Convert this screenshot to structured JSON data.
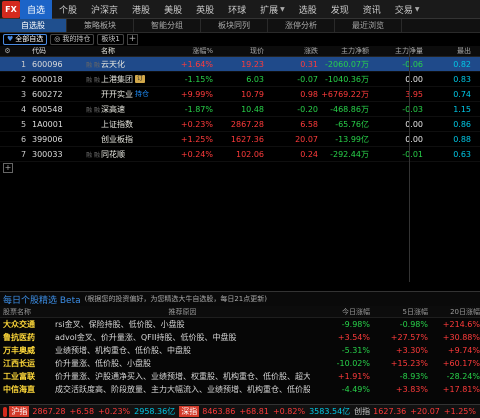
{
  "nav": {
    "logo": "FX",
    "tabs": [
      {
        "label": "自选",
        "caret": false,
        "active": true
      },
      {
        "label": "个股",
        "caret": false
      },
      {
        "label": "沪深京",
        "caret": false
      },
      {
        "label": "港股",
        "caret": false
      },
      {
        "label": "美股",
        "caret": false
      },
      {
        "label": "英股",
        "caret": false
      },
      {
        "label": "环球",
        "caret": false
      },
      {
        "label": "扩展",
        "caret": true
      },
      {
        "label": "选股",
        "caret": false
      },
      {
        "label": "发现",
        "caret": false
      },
      {
        "label": "资讯",
        "caret": false
      },
      {
        "label": "交易",
        "caret": true
      }
    ]
  },
  "subtabs": [
    "自选股",
    "策略板块",
    "智能分组",
    "板块同列",
    "涨停分析",
    "最近浏览"
  ],
  "toolbar": {
    "all": "全部自选",
    "mine": "我的持仓",
    "block": "板块1",
    "plus": "+"
  },
  "table": {
    "headers": {
      "code": "代码",
      "name": "名称",
      "chg": "涨幅%",
      "price": "现价",
      "diff": "涨跌",
      "main": "主力净额",
      "net": "主力净量",
      "last": "最出"
    },
    "rows": [
      {
        "idx": "1",
        "code": "600096",
        "tag": "融 融",
        "name": "云天化",
        "badge": "",
        "hold": "",
        "chg": "+1.64%",
        "price": "19.23",
        "diff": "0.31",
        "main": "-2060.07万",
        "net": "-0.06",
        "last": "0.82",
        "cls": {
          "chg": "red",
          "price": "red",
          "diff": "red",
          "main": "green",
          "net": "green",
          "last": "cyan"
        }
      },
      {
        "idx": "2",
        "code": "600018",
        "tag": "融 融",
        "name": "上港集团",
        "badge": "订",
        "hold": "",
        "chg": "-1.15%",
        "price": "6.03",
        "diff": "-0.07",
        "main": "-1040.36万",
        "net": "0.00",
        "last": "0.83",
        "cls": {
          "chg": "green",
          "price": "green",
          "diff": "green",
          "main": "green",
          "net": "white",
          "last": "cyan"
        }
      },
      {
        "idx": "3",
        "code": "600272",
        "tag": "",
        "name": "开开实业",
        "badge": "",
        "hold": "持仓",
        "chg": "+9.99%",
        "price": "10.79",
        "diff": "0.98",
        "main": "+6769.22万",
        "net": "3.95",
        "last": "0.74",
        "cls": {
          "chg": "red",
          "price": "red",
          "diff": "red",
          "main": "red",
          "net": "red",
          "last": "cyan"
        }
      },
      {
        "idx": "4",
        "code": "600548",
        "tag": "融 融",
        "name": "深高速",
        "badge": "",
        "hold": "",
        "chg": "-1.87%",
        "price": "10.48",
        "diff": "-0.20",
        "main": "-468.86万",
        "net": "-0.03",
        "last": "1.15",
        "cls": {
          "chg": "green",
          "price": "green",
          "diff": "green",
          "main": "green",
          "net": "green",
          "last": "cyan"
        }
      },
      {
        "idx": "5",
        "code": "1A0001",
        "tag": "",
        "name": "上证指数",
        "badge": "",
        "hold": "",
        "chg": "+0.23%",
        "price": "2867.28",
        "diff": "6.58",
        "main": "-65.76亿",
        "net": "0.00",
        "last": "0.86",
        "cls": {
          "chg": "red",
          "price": "red",
          "diff": "red",
          "main": "green",
          "net": "white",
          "last": "cyan"
        }
      },
      {
        "idx": "6",
        "code": "399006",
        "tag": "",
        "name": "创业板指",
        "badge": "",
        "hold": "",
        "chg": "+1.25%",
        "price": "1627.36",
        "diff": "20.07",
        "main": "-13.99亿",
        "net": "0.00",
        "last": "0.88",
        "cls": {
          "chg": "red",
          "price": "red",
          "diff": "red",
          "main": "green",
          "net": "white",
          "last": "cyan"
        }
      },
      {
        "idx": "7",
        "code": "300033",
        "tag": "融 融",
        "name": "同花顺",
        "badge": "",
        "hold": "",
        "chg": "+0.24%",
        "price": "102.06",
        "diff": "0.24",
        "main": "-292.44万",
        "net": "-0.01",
        "last": "0.63",
        "cls": {
          "chg": "red",
          "price": "red",
          "diff": "red",
          "main": "green",
          "net": "green",
          "last": "cyan"
        }
      }
    ],
    "add": "+"
  },
  "panel": {
    "title": "每日个股精选 Beta",
    "subtitle": "(根据您的投资偏好，为您精选大牛自选股，每日21点更新)",
    "headers": {
      "name": "股票名称",
      "reason": "推荐原因",
      "today": "今日涨幅",
      "five": "5日涨幅",
      "twenty": "20日涨幅"
    },
    "rows": [
      {
        "name": "大众交通",
        "reason": "rsi金叉、保险持股、低价股、小盘股",
        "today": "-9.98%",
        "five": "-0.98%",
        "twenty": "+214.6%",
        "cls": {
          "today": "green",
          "five": "green",
          "twenty": "red"
        }
      },
      {
        "name": "鲁抗医药",
        "reason": "advol金叉、价升量涨、QFII持股、低价股、中盘股",
        "today": "+3.54%",
        "five": "+27.57%",
        "twenty": "+30.88%",
        "cls": {
          "today": "red",
          "five": "red",
          "twenty": "red"
        }
      },
      {
        "name": "万丰奥威",
        "reason": "业绩预增、机构重仓、低价股、中盘股",
        "today": "-5.31%",
        "five": "+3.30%",
        "twenty": "+9.74%",
        "cls": {
          "today": "green",
          "five": "red",
          "twenty": "red"
        }
      },
      {
        "name": "江西长运",
        "reason": "价升量涨、低价股、小盘股",
        "today": "-10.02%",
        "five": "+15.23%",
        "twenty": "+60.17%",
        "cls": {
          "today": "green",
          "five": "red",
          "twenty": "red"
        }
      },
      {
        "name": "工业富联",
        "reason": "价升量涨、沪股通净买入、业绩预增、权重股、机构重仓、低价股、超大盘股",
        "today": "+1.91%",
        "five": "-8.93%",
        "twenty": "-28.24%",
        "cls": {
          "today": "red",
          "five": "green",
          "twenty": "green"
        }
      },
      {
        "name": "中信海直",
        "reason": "成交活跃度高、阶段放量、主力大幅流入、业绩预增、机构重仓、低价股、中盘股",
        "today": "-4.49%",
        "five": "+3.83%",
        "twenty": "+17.81%",
        "cls": {
          "today": "green",
          "five": "red",
          "twenty": "red"
        }
      }
    ]
  },
  "status": {
    "items": [
      {
        "label": "沪指",
        "box": true,
        "vals": [
          [
            "2867.28",
            "red"
          ],
          [
            "+6.58",
            "red"
          ],
          [
            "+0.23%",
            "red"
          ],
          [
            "2958.36亿",
            "cyan"
          ]
        ]
      },
      {
        "label": "深指",
        "box": true,
        "vals": [
          [
            "8463.86",
            "red"
          ],
          [
            "+68.81",
            "red"
          ],
          [
            "+0.82%",
            "red"
          ],
          [
            "3583.54亿",
            "cyan"
          ]
        ]
      },
      {
        "label": "创指",
        "box": false,
        "vals": [
          [
            "1627.36",
            "red"
          ],
          [
            "+20.07",
            "red"
          ],
          [
            "+1.25%",
            "red"
          ]
        ]
      }
    ]
  }
}
